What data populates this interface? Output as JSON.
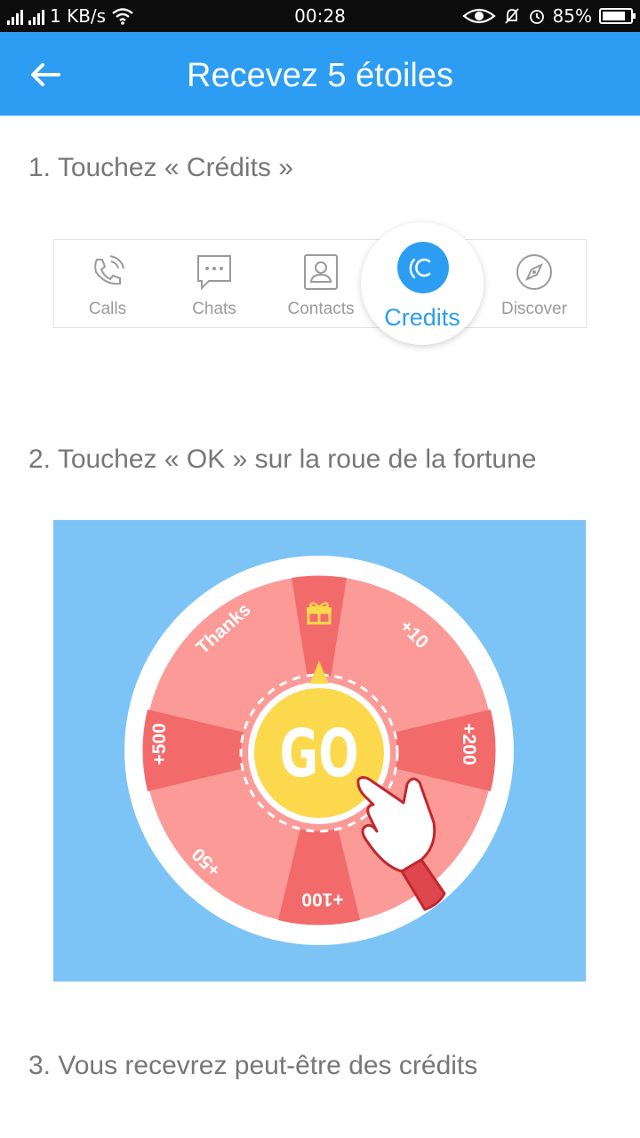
{
  "status_bar": {
    "network_speed": "1 KB/s",
    "time": "00:28",
    "battery": "85%",
    "battery_level": 0.85
  },
  "header": {
    "title": "Recevez 5 étoiles",
    "back_icon": "arrow-left-icon"
  },
  "steps": [
    "1. Touchez « Crédits »",
    "2. Touchez « OK » sur la roue de la fortune",
    "3. Vous recevrez peut-être des crédits"
  ],
  "tabbar": {
    "tabs": [
      {
        "label": "Calls",
        "icon": "phone-icon"
      },
      {
        "label": "Chats",
        "icon": "chat-icon"
      },
      {
        "label": "Contacts",
        "icon": "contact-card-icon"
      },
      {
        "label": "Credits",
        "icon": "credits-icon",
        "selected": true
      },
      {
        "label": "Discover",
        "icon": "compass-icon"
      }
    ]
  },
  "wheel": {
    "center_label": "GO",
    "segments": [
      "Thanks",
      "+10",
      "+200",
      "+100",
      "+50",
      "+500"
    ],
    "gift_icon": "gift-icon",
    "pointer_icon": "hand-pointer-icon"
  },
  "colors": {
    "accent": "#2c9df2",
    "panel_bg": "#7cc4f5",
    "wheel_dark": "#f26a6a",
    "wheel_light": "#fb9a96",
    "go_yellow": "#fcd84c"
  }
}
